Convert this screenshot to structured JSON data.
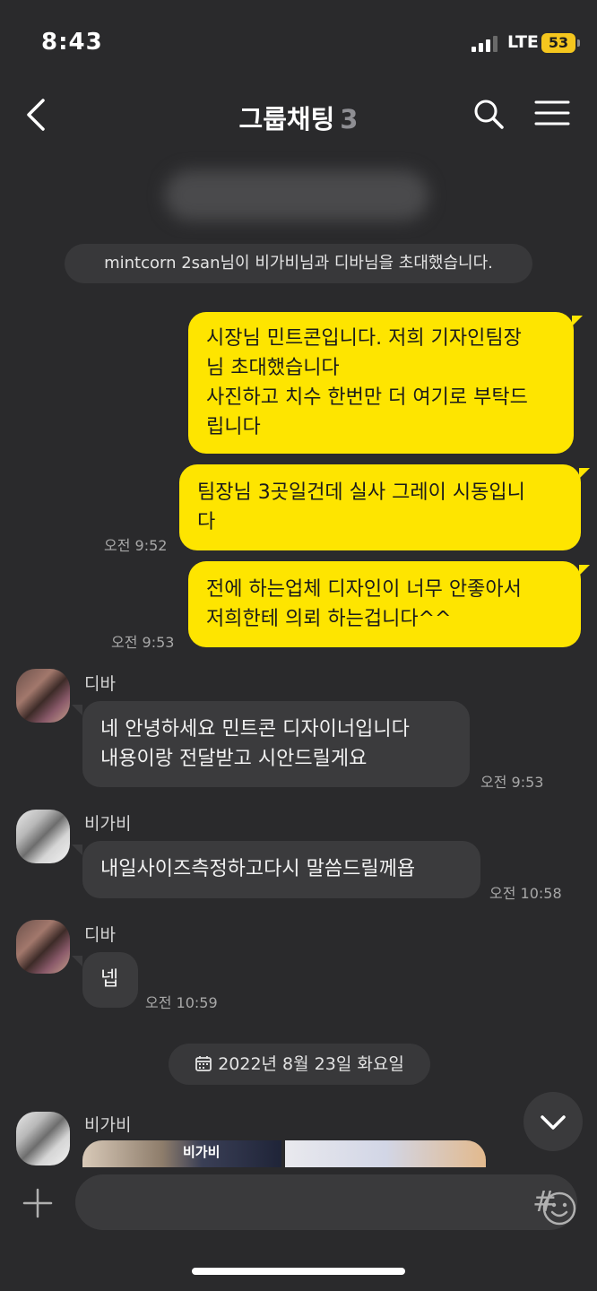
{
  "status_bar": {
    "time": "8:43",
    "network": "LTE",
    "battery": "53"
  },
  "header": {
    "title": "그룹채팅",
    "member_count": "3"
  },
  "notice": "mintcorn 2san님이 비가비님과 디바님을 초대했습니다.",
  "messages": [
    {
      "from": "me",
      "text": "시장님 민트콘입니다. 저희 기자인팀장\n님 초대했습니다\n사진하고 치수 한번만 더 여기로 부탁드\n립니다",
      "time": ""
    },
    {
      "from": "me",
      "text": "팀장님 3곳일건데 실사 그레이 시동입니\n다",
      "time": "오전 9:52"
    },
    {
      "from": "me",
      "text": "전에 하는업체 디자인이 너무 안좋아서\n저희한테 의뢰 하는겁니다^^",
      "time": "오전 9:53"
    },
    {
      "from": "디바",
      "text": "네 안녕하세요 민트콘 디자이너입니다\n내용이랑 전달받고 시안드릴게요",
      "time": "오전 9:53"
    },
    {
      "from": "비가비",
      "text": "내일사이즈측정하고다시 말씀드릴께욥",
      "time": "오전 10:58"
    },
    {
      "from": "디바",
      "text": "넵",
      "time": "오전 10:59"
    }
  ],
  "date_divider": "2022년 8월 23일 화요일",
  "last_sender": "비가비",
  "image_preview_text": "비가비",
  "composer": {
    "placeholder": "",
    "hash_label": "#"
  },
  "colors": {
    "bubble_me": "#fee500",
    "bubble_other": "#3b3b3d",
    "background": "#2a2a2c"
  }
}
